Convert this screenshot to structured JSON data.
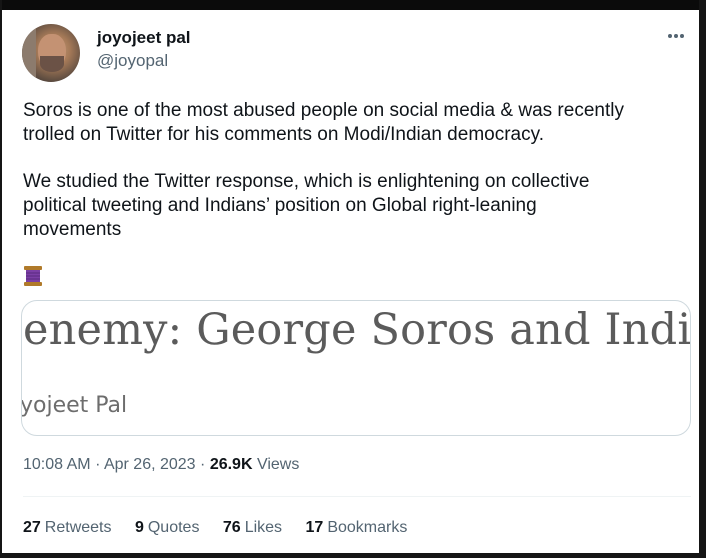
{
  "user": {
    "display_name": "joyojeet pal",
    "handle": "@joyopal"
  },
  "tweet": {
    "paragraph1_line1": "Soros is one of the most abused people on social media & was recently",
    "paragraph1_line2": "trolled on Twitter for his comments on Modi/Indian democracy.",
    "paragraph2_line1": "We studied the Twitter response, which is enlightening on collective",
    "paragraph2_line2": "political tweeting and Indians’ position on Global right-leaning",
    "paragraph2_line3": "movements",
    "thread_icon": "spool-of-thread-emoji"
  },
  "card": {
    "headline": "enemy: George Soros and India",
    "author": "yojeet Pal"
  },
  "meta": {
    "time": "10:08 AM",
    "separator": "·",
    "date": "Apr 26, 2023",
    "views_count": "26.9K",
    "views_label": "Views"
  },
  "stats": {
    "retweets_count": "27",
    "retweets_label": "Retweets",
    "quotes_count": "9",
    "quotes_label": "Quotes",
    "likes_count": "76",
    "likes_label": "Likes",
    "bookmarks_count": "17",
    "bookmarks_label": "Bookmarks"
  },
  "colors": {
    "text_primary": "#0f1419",
    "text_secondary": "#536471",
    "border": "#cfd9de"
  }
}
